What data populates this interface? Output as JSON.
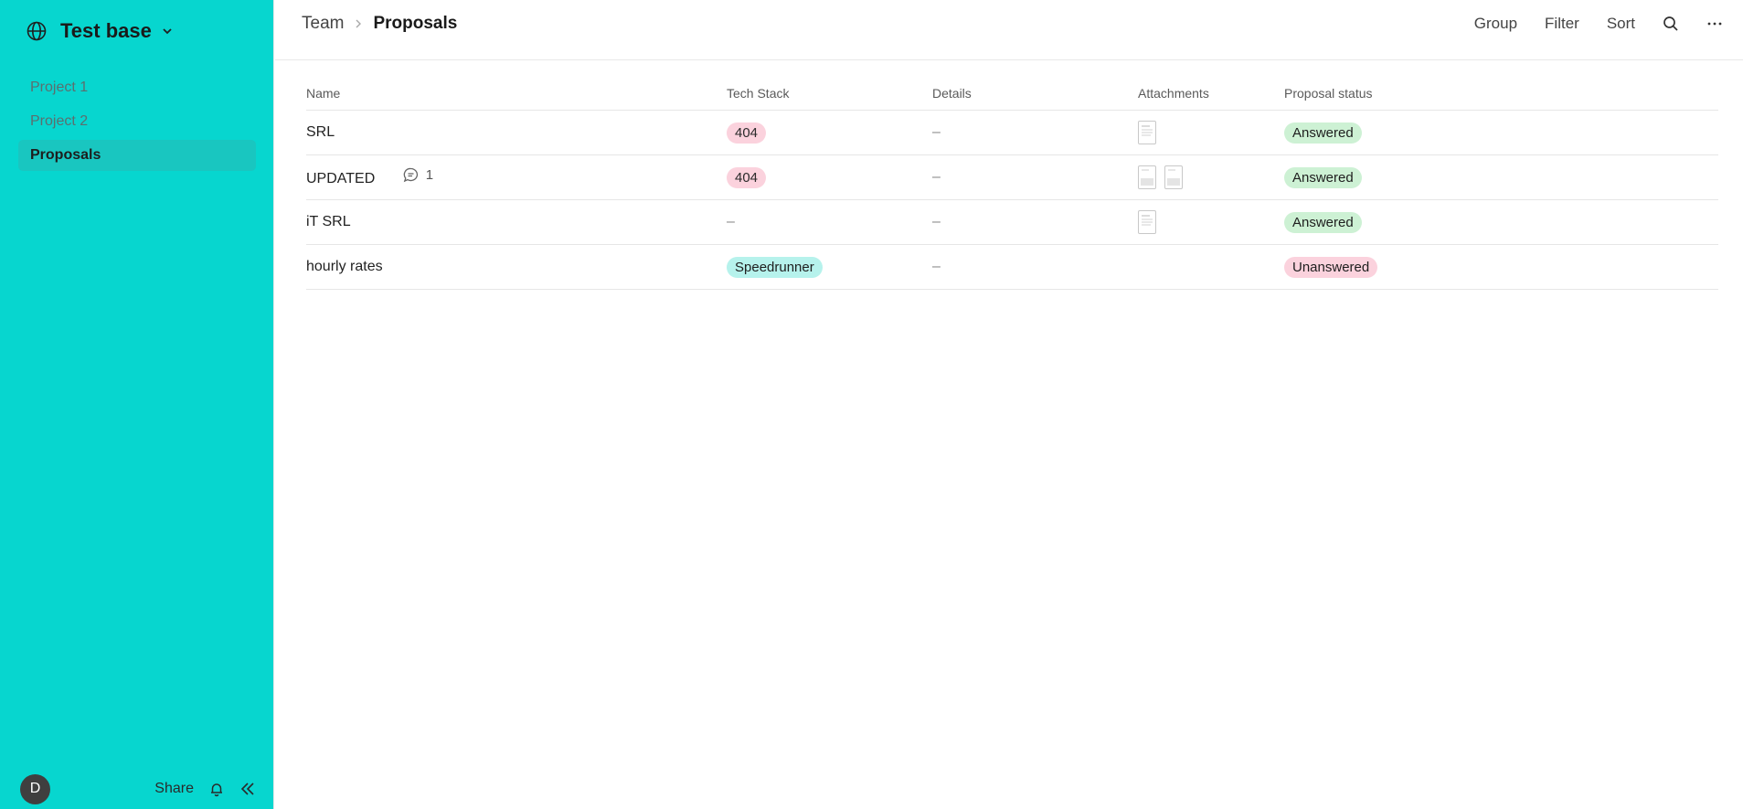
{
  "sidebar": {
    "workspace": "Test base",
    "items": [
      {
        "label": "Project 1"
      },
      {
        "label": "Project 2"
      },
      {
        "label": "Proposals"
      }
    ],
    "footer": {
      "avatar_initial": "D",
      "share_label": "Share"
    }
  },
  "header": {
    "breadcrumb_parent": "Team",
    "breadcrumb_current": "Proposals",
    "actions": {
      "group": "Group",
      "filter": "Filter",
      "sort": "Sort"
    }
  },
  "table": {
    "columns": [
      "Name",
      "Tech Stack",
      "Details",
      "Attachments",
      "Proposal status"
    ],
    "rows": [
      {
        "name": "SRL",
        "comments": "",
        "tech": "404",
        "details": "–",
        "attachments": 1,
        "status": "Answered"
      },
      {
        "name": "UPDATED",
        "comments": "1",
        "tech": "404",
        "details": "–",
        "attachments": 2,
        "status": "Answered"
      },
      {
        "name": "iT SRL",
        "comments": "",
        "tech": "–",
        "details": "–",
        "attachments": 1,
        "status": "Answered"
      },
      {
        "name": "hourly rates",
        "comments": "",
        "tech": "Speedrunner",
        "details": "–",
        "attachments": 0,
        "status": "Unanswered"
      }
    ]
  },
  "colors": {
    "sidebar_bg": "#07d6cf",
    "sidebar_active": "#19c6c0",
    "pill_pink": "#fbd2dd",
    "pill_green": "#cdf1d4",
    "pill_teal": "#b6f2ec"
  }
}
